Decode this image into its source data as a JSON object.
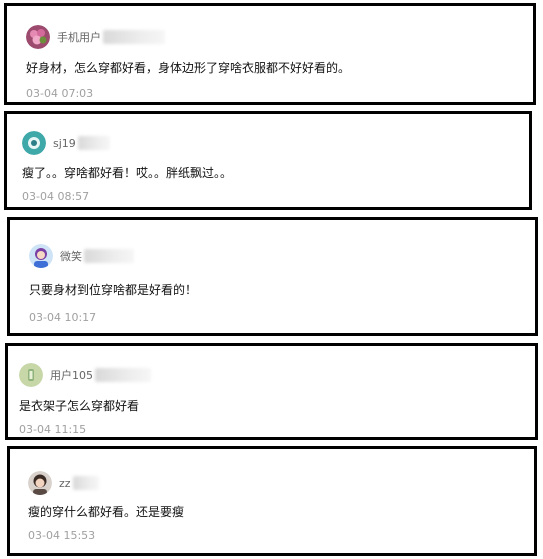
{
  "comments": [
    {
      "username": "手机用户",
      "text": "好身材，怎么穿都好看，身体边形了穿啥衣服都不好好看的。",
      "time": "03-04 07:03",
      "avatar": "flower-avatar"
    },
    {
      "username": "sj19",
      "text": "瘦了。。穿啥都好看！哎。。胖纸飘过。。",
      "time": "03-04 08:57",
      "avatar": "teal-avatar"
    },
    {
      "username": "微笑",
      "text": "只要身材到位穿啥都是好看的！",
      "time": "03-04 10:17",
      "avatar": "cartoon-avatar"
    },
    {
      "username": "用户105",
      "text": "是衣架子怎么穿都好看",
      "time": "03-04 11:15",
      "avatar": "default-avatar"
    },
    {
      "username": "zz",
      "text": "瘦的穿什么都好看。还是要瘦",
      "time": "03-04 15:53",
      "avatar": "photo-avatar"
    }
  ]
}
